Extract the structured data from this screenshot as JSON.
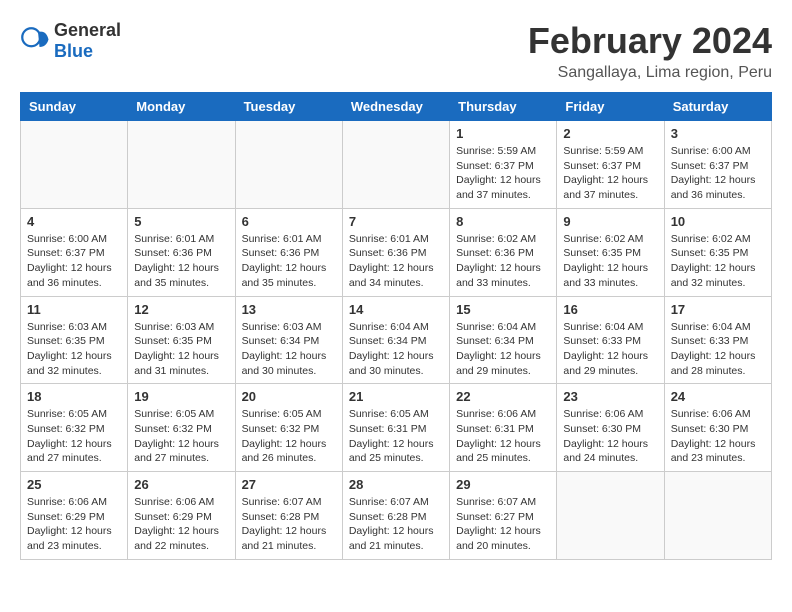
{
  "header": {
    "logo_general": "General",
    "logo_blue": "Blue",
    "title": "February 2024",
    "subtitle": "Sangallaya, Lima region, Peru"
  },
  "calendar": {
    "days_of_week": [
      "Sunday",
      "Monday",
      "Tuesday",
      "Wednesday",
      "Thursday",
      "Friday",
      "Saturday"
    ],
    "weeks": [
      [
        {
          "day": "",
          "info": ""
        },
        {
          "day": "",
          "info": ""
        },
        {
          "day": "",
          "info": ""
        },
        {
          "day": "",
          "info": ""
        },
        {
          "day": "1",
          "info": "Sunrise: 5:59 AM\nSunset: 6:37 PM\nDaylight: 12 hours\nand 37 minutes."
        },
        {
          "day": "2",
          "info": "Sunrise: 5:59 AM\nSunset: 6:37 PM\nDaylight: 12 hours\nand 37 minutes."
        },
        {
          "day": "3",
          "info": "Sunrise: 6:00 AM\nSunset: 6:37 PM\nDaylight: 12 hours\nand 36 minutes."
        }
      ],
      [
        {
          "day": "4",
          "info": "Sunrise: 6:00 AM\nSunset: 6:37 PM\nDaylight: 12 hours\nand 36 minutes."
        },
        {
          "day": "5",
          "info": "Sunrise: 6:01 AM\nSunset: 6:36 PM\nDaylight: 12 hours\nand 35 minutes."
        },
        {
          "day": "6",
          "info": "Sunrise: 6:01 AM\nSunset: 6:36 PM\nDaylight: 12 hours\nand 35 minutes."
        },
        {
          "day": "7",
          "info": "Sunrise: 6:01 AM\nSunset: 6:36 PM\nDaylight: 12 hours\nand 34 minutes."
        },
        {
          "day": "8",
          "info": "Sunrise: 6:02 AM\nSunset: 6:36 PM\nDaylight: 12 hours\nand 33 minutes."
        },
        {
          "day": "9",
          "info": "Sunrise: 6:02 AM\nSunset: 6:35 PM\nDaylight: 12 hours\nand 33 minutes."
        },
        {
          "day": "10",
          "info": "Sunrise: 6:02 AM\nSunset: 6:35 PM\nDaylight: 12 hours\nand 32 minutes."
        }
      ],
      [
        {
          "day": "11",
          "info": "Sunrise: 6:03 AM\nSunset: 6:35 PM\nDaylight: 12 hours\nand 32 minutes."
        },
        {
          "day": "12",
          "info": "Sunrise: 6:03 AM\nSunset: 6:35 PM\nDaylight: 12 hours\nand 31 minutes."
        },
        {
          "day": "13",
          "info": "Sunrise: 6:03 AM\nSunset: 6:34 PM\nDaylight: 12 hours\nand 30 minutes."
        },
        {
          "day": "14",
          "info": "Sunrise: 6:04 AM\nSunset: 6:34 PM\nDaylight: 12 hours\nand 30 minutes."
        },
        {
          "day": "15",
          "info": "Sunrise: 6:04 AM\nSunset: 6:34 PM\nDaylight: 12 hours\nand 29 minutes."
        },
        {
          "day": "16",
          "info": "Sunrise: 6:04 AM\nSunset: 6:33 PM\nDaylight: 12 hours\nand 29 minutes."
        },
        {
          "day": "17",
          "info": "Sunrise: 6:04 AM\nSunset: 6:33 PM\nDaylight: 12 hours\nand 28 minutes."
        }
      ],
      [
        {
          "day": "18",
          "info": "Sunrise: 6:05 AM\nSunset: 6:32 PM\nDaylight: 12 hours\nand 27 minutes."
        },
        {
          "day": "19",
          "info": "Sunrise: 6:05 AM\nSunset: 6:32 PM\nDaylight: 12 hours\nand 27 minutes."
        },
        {
          "day": "20",
          "info": "Sunrise: 6:05 AM\nSunset: 6:32 PM\nDaylight: 12 hours\nand 26 minutes."
        },
        {
          "day": "21",
          "info": "Sunrise: 6:05 AM\nSunset: 6:31 PM\nDaylight: 12 hours\nand 25 minutes."
        },
        {
          "day": "22",
          "info": "Sunrise: 6:06 AM\nSunset: 6:31 PM\nDaylight: 12 hours\nand 25 minutes."
        },
        {
          "day": "23",
          "info": "Sunrise: 6:06 AM\nSunset: 6:30 PM\nDaylight: 12 hours\nand 24 minutes."
        },
        {
          "day": "24",
          "info": "Sunrise: 6:06 AM\nSunset: 6:30 PM\nDaylight: 12 hours\nand 23 minutes."
        }
      ],
      [
        {
          "day": "25",
          "info": "Sunrise: 6:06 AM\nSunset: 6:29 PM\nDaylight: 12 hours\nand 23 minutes."
        },
        {
          "day": "26",
          "info": "Sunrise: 6:06 AM\nSunset: 6:29 PM\nDaylight: 12 hours\nand 22 minutes."
        },
        {
          "day": "27",
          "info": "Sunrise: 6:07 AM\nSunset: 6:28 PM\nDaylight: 12 hours\nand 21 minutes."
        },
        {
          "day": "28",
          "info": "Sunrise: 6:07 AM\nSunset: 6:28 PM\nDaylight: 12 hours\nand 21 minutes."
        },
        {
          "day": "29",
          "info": "Sunrise: 6:07 AM\nSunset: 6:27 PM\nDaylight: 12 hours\nand 20 minutes."
        },
        {
          "day": "",
          "info": ""
        },
        {
          "day": "",
          "info": ""
        }
      ]
    ]
  }
}
